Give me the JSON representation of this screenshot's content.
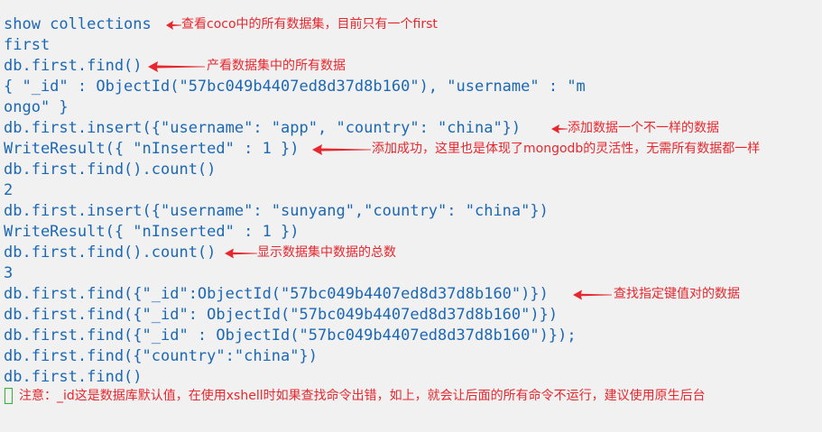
{
  "terminal": {
    "lines": [
      "show collections",
      "first",
      "db.first.find()",
      "{ \"_id\" : ObjectId(\"57bc049b4407ed8d37d8b160\"), \"username\" : \"m",
      "ongo\" }",
      "db.first.insert({\"username\": \"app\", \"country\": \"china\"})",
      "WriteResult({ \"nInserted\" : 1 })",
      "db.first.find().count()",
      "2",
      "db.first.insert({\"username\": \"sunyang\",\"country\": \"china\"})",
      "WriteResult({ \"nInserted\" : 1 })",
      "db.first.find().count()",
      "3",
      "db.first.find({\"_id\":ObjectId(\"57bc049b4407ed8d37d8b160\")})",
      "db.first.find({\"_id\": ObjectId(\"57bc049b4407ed8d37d8b160\")})",
      "db.first.find({\"_id\" : ObjectId(\"57bc049b4407ed8d37d8b160\")});",
      "db.first.find({\"country\":\"china\"})",
      "db.first.find()"
    ]
  },
  "annotations": {
    "show_collections": "查看coco中的所有数据集，目前只有一个first",
    "find_all": "产看数据集中的所有数据",
    "insert_new": "添加数据一个不一样的数据",
    "insert_success": "添加成功，这里也是体现了mongodb的灵活性，无需所有数据都一样",
    "count_total": "显示数据集中数据的总数",
    "find_by_key": "查找指定键值对的数据",
    "bottom_note": "注意：_id这是数据库默认值，在使用xshell时如果查找命令出错，如上，就会让后面的所有命令不运行，建议使用原生后台"
  },
  "colors": {
    "terminal_background": "#f1f1f1",
    "command_text": "#1c68b5",
    "annotation_text": "#e6282e",
    "cursor": "#2fb532"
  }
}
